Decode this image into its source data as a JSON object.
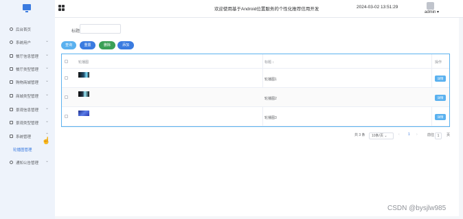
{
  "header": {
    "welcome": "欢迎使用基于Android位置服务的个性化推荐信用开发",
    "datetime": "2024-03-02 13:51:29",
    "username": "admin ▾"
  },
  "sidebar": {
    "items": [
      {
        "label": "后台首页",
        "chevron": ""
      },
      {
        "label": "系统用户",
        "chevron": "⌄"
      },
      {
        "label": "餐厅信息管理",
        "chevron": "⌄"
      },
      {
        "label": "餐厅类型管理",
        "chevron": "⌄"
      },
      {
        "label": "购物商城管理",
        "chevron": "⌄"
      },
      {
        "label": "商城类型管理",
        "chevron": "⌄"
      },
      {
        "label": "景观信息管理",
        "chevron": "⌄"
      },
      {
        "label": "景观类型管理",
        "chevron": "⌄"
      },
      {
        "label": "系统管理",
        "chevron": "⌃"
      },
      {
        "label": "通知公告管理",
        "chevron": "⌄"
      }
    ],
    "submenu_active": "轮播图管理"
  },
  "search": {
    "label": "标题",
    "value": ""
  },
  "toolbar": {
    "query": "查询",
    "reset": "重置",
    "delete": "删除",
    "add": "添加"
  },
  "table": {
    "columns": [
      "轮播图",
      "标题 ↕",
      "操作"
    ],
    "rows": [
      {
        "title": "轮播图1",
        "action": "详情"
      },
      {
        "title": "轮播图2",
        "action": "详情"
      },
      {
        "title": "轮播图3",
        "action": "详情"
      }
    ]
  },
  "pagination": {
    "total": "共 3 条",
    "page_size": "10条/页 ⌄",
    "prev": "‹",
    "current": "1",
    "next": "›",
    "goto_label": "前往",
    "goto_value": "1",
    "unit": "页"
  },
  "watermark": "CSDN @bysjlw985",
  "colors": {
    "accent": "#3a7be0",
    "info": "#5ab1ef",
    "success": "#3aa056",
    "sidebar_bg": "#eef3fb"
  }
}
